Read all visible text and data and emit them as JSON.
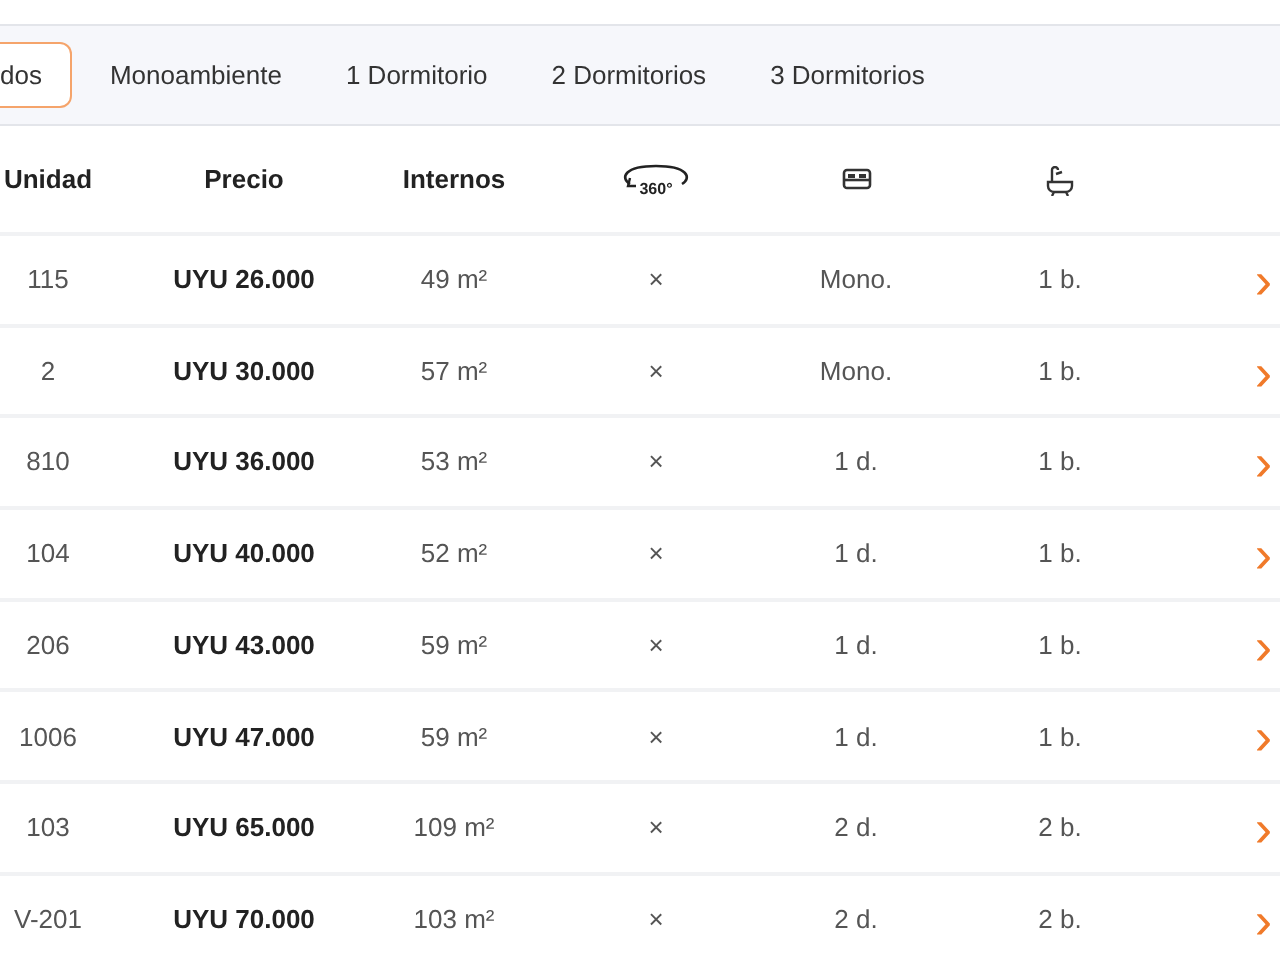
{
  "tabs": [
    {
      "label": "dos",
      "selected": true
    },
    {
      "label": "Monoambiente",
      "selected": false
    },
    {
      "label": "1 Dormitorio",
      "selected": false
    },
    {
      "label": "2 Dormitorios",
      "selected": false
    },
    {
      "label": "3 Dormitorios",
      "selected": false
    }
  ],
  "table": {
    "columns": [
      {
        "kind": "text",
        "label": "Unidad"
      },
      {
        "kind": "text",
        "label": "Precio"
      },
      {
        "kind": "text",
        "label": "Internos"
      },
      {
        "kind": "tour360",
        "label": "360°"
      },
      {
        "kind": "bed"
      },
      {
        "kind": "bath"
      }
    ],
    "rows": [
      {
        "unidad": "115",
        "precio": "UYU 26.000",
        "internos": "49 m²",
        "tour": "×",
        "dormitorios": "Mono.",
        "banos": "1 b.",
        "arrow": "›"
      },
      {
        "unidad": "2",
        "precio": "UYU 30.000",
        "internos": "57 m²",
        "tour": "×",
        "dormitorios": "Mono.",
        "banos": "1 b.",
        "arrow": "›"
      },
      {
        "unidad": "810",
        "precio": "UYU 36.000",
        "internos": "53 m²",
        "tour": "×",
        "dormitorios": "1 d.",
        "banos": "1 b.",
        "arrow": "›"
      },
      {
        "unidad": "104",
        "precio": "UYU 40.000",
        "internos": "52 m²",
        "tour": "×",
        "dormitorios": "1 d.",
        "banos": "1 b.",
        "arrow": "›"
      },
      {
        "unidad": "206",
        "precio": "UYU 43.000",
        "internos": "59 m²",
        "tour": "×",
        "dormitorios": "1 d.",
        "banos": "1 b.",
        "arrow": "›"
      },
      {
        "unidad": "1006",
        "precio": "UYU 47.000",
        "internos": "59 m²",
        "tour": "×",
        "dormitorios": "1 d.",
        "banos": "1 b.",
        "arrow": "›"
      },
      {
        "unidad": "103",
        "precio": "UYU 65.000",
        "internos": "109 m²",
        "tour": "×",
        "dormitorios": "2 d.",
        "banos": "2 b.",
        "arrow": "›"
      },
      {
        "unidad": "V-201",
        "precio": "UYU 70.000",
        "internos": "103 m²",
        "tour": "×",
        "dormitorios": "2 d.",
        "banos": "2 b.",
        "arrow": "›"
      }
    ]
  }
}
